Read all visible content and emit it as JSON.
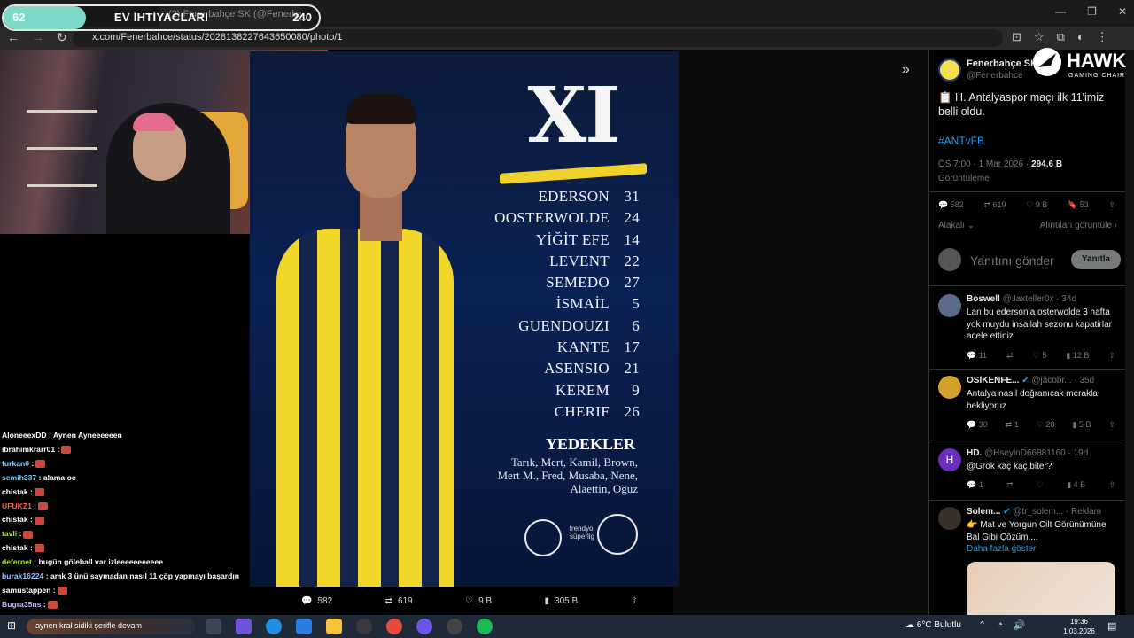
{
  "stream_goal": {
    "left_value": "62",
    "title": "EV İHTİYACLARI",
    "right_value": "240",
    "progress": 0.26
  },
  "browser": {
    "tab_title": "(2) Fenerbahçe SK (@Fenerbah...",
    "url": "x.com/Fenerbahce/status/2028138227643650080/photo/1"
  },
  "media": {
    "headline": "XI",
    "lineup": [
      {
        "name": "EDERSON",
        "number": "31"
      },
      {
        "name": "OOSTERWOLDE",
        "number": "24"
      },
      {
        "name": "YİĞİT EFE",
        "number": "14"
      },
      {
        "name": "LEVENT",
        "number": "22"
      },
      {
        "name": "SEMEDO",
        "number": "27"
      },
      {
        "name": "İSMAİL",
        "number": "5"
      },
      {
        "name": "GUENDOUZI",
        "number": "6"
      },
      {
        "name": "KANTE",
        "number": "17"
      },
      {
        "name": "ASENSIO",
        "number": "21"
      },
      {
        "name": "KEREM",
        "number": "9"
      },
      {
        "name": "CHERIF",
        "number": "26"
      }
    ],
    "subs_title": "YEDEKLER",
    "subs": "Tarık, Mert, Kamil, Brown, Mert M., Fred, Musaba, Nene, Alaettin, Oğuz",
    "sponsor_text": "trendyol süperlig",
    "actions": {
      "replies": "582",
      "reposts": "619",
      "likes": "9 B",
      "views": "305 B"
    }
  },
  "chat": [
    {
      "user": "AloneeexDD",
      "color": "#ffffff",
      "text": ": Aynen Ayneeeeeen"
    },
    {
      "user": "ibrahimkrarr01",
      "color": "#ffffff",
      "text": ":"
    },
    {
      "user": "furkan0",
      "color": "#7dd3fc",
      "text": ":"
    },
    {
      "user": "semih337",
      "color": "#7dd3fc",
      "text": ": alama oc"
    },
    {
      "user": "chistak",
      "color": "#ffffff",
      "text": ":"
    },
    {
      "user": "UFUKZ1",
      "color": "#ff5a5a",
      "text": ":"
    },
    {
      "user": "chistak",
      "color": "#ffffff",
      "text": ":"
    },
    {
      "user": "tavli",
      "color": "#a3e635",
      "text": ":"
    },
    {
      "user": "chistak",
      "color": "#ffffff",
      "text": ":"
    },
    {
      "user": "defernet",
      "color": "#a3e635",
      "text": ": bugün göleball var izleeeeeeeeeee"
    },
    {
      "user": "burak16224",
      "color": "#93c5fd",
      "text": ": amk 3 ünü saymadan nasıl 11 çöp yapmayı başardın"
    },
    {
      "user": "samustappen",
      "color": "#ffffff",
      "text": ":"
    },
    {
      "user": "Bugra35ns",
      "color": "#c4b5fd",
      "text": ":"
    },
    {
      "user": "",
      "color": "#ffffff",
      "text": "aynen kral sidiki şerifle devam"
    }
  ],
  "tweet": {
    "name": "Fenerbahçe SK",
    "handle": "@Fenerbahce",
    "text": "📋 H. Antalyaspor maçı ilk 11'imiz belli oldu.",
    "hashtag": "#ANTvFB",
    "time": "ÖS 7:00 · 1 Mar 2026 · ",
    "views": "294,6 B",
    "views_label": "Görüntüleme",
    "stats": {
      "replies": "582",
      "reposts": "619",
      "likes": "9 B",
      "bookmarks": "53"
    },
    "sort_label": "Alakalı",
    "quotes_label": "Alıntıları görüntüle",
    "reply_placeholder": "Yanıtını gönder",
    "reply_button": "Yanıtla"
  },
  "replies": [
    {
      "name": "Boswell",
      "handle": "@Jaxteller0x · 34d",
      "text": "Lan bu edersonla osterwolde 3 hafta yok muydu insallah sezonu kapatirlar acele ettiniz",
      "r": "11",
      "rt": "",
      "l": "5",
      "v": "12 B",
      "color": "#5b6b8a"
    },
    {
      "name": "OSİKENFE...",
      "handle": "@jacobr... · 35d",
      "text": "Antalya nasıl doğranıcak merakla bekliyoruz",
      "r": "30",
      "rt": "1",
      "l": "28",
      "v": "5 B",
      "color": "#d1a02d"
    },
    {
      "name": "HD.",
      "handle": "@HseyinD66881160 · 19d",
      "text": "@Grok kaç kaç biter?",
      "r": "1",
      "rt": "",
      "l": "",
      "v": "4 B",
      "color": "#6a2dbd"
    },
    {
      "name": "Solem...",
      "handle": "@tr_solem... · Reklam",
      "text": "👉 Mat ve Yorgun Cilt Görünümüne Bal Gibi Çözüm....",
      "more": "Daha fazla göster",
      "color": "#3a3026"
    }
  ],
  "taskbar": {
    "search_text": "aynen kral sidiki şerifle devam",
    "weather": "6°C  Bulutlu",
    "time": "19:36",
    "date": "1.03.2026"
  },
  "brand": {
    "hawk": "HAWK",
    "hawk_sub": "GAMING CHAIR"
  }
}
